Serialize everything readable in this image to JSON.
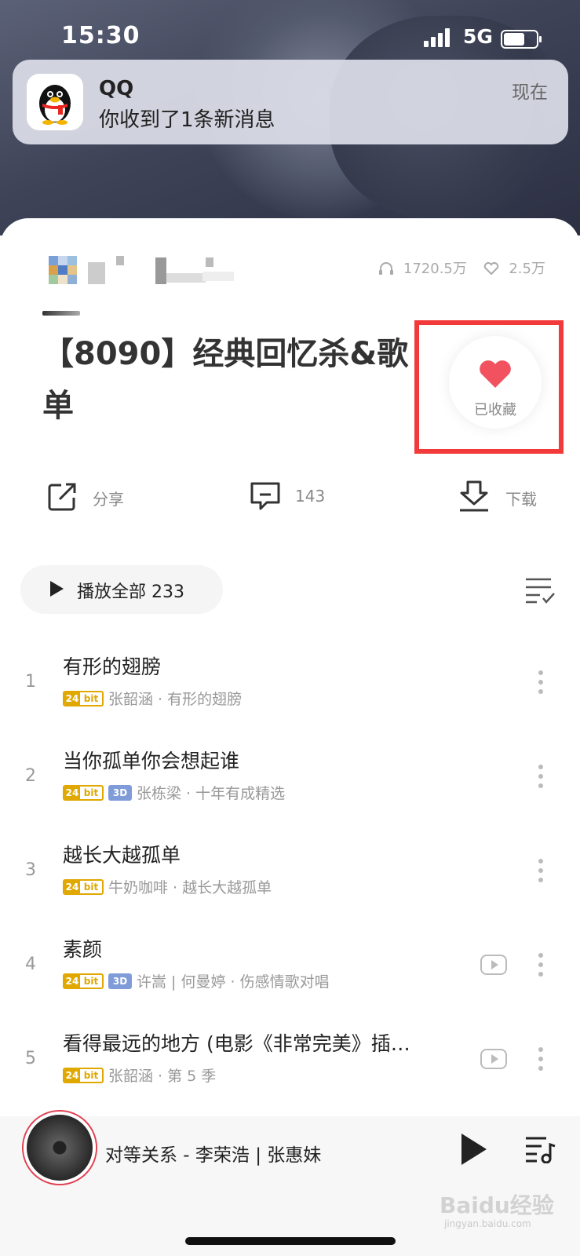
{
  "status_bar": {
    "time": "15:30",
    "network": "5G"
  },
  "notification": {
    "app": "QQ",
    "message": "你收到了1条新消息",
    "when": "现在"
  },
  "playlist": {
    "play_count": "1720.5万",
    "like_count": "2.5万",
    "title": "【8090】经典回忆杀&歌单",
    "favorite_label": "已收藏",
    "actions": {
      "share": "分享",
      "comments": "143",
      "download": "下载"
    },
    "play_all": "播放全部 233"
  },
  "badges": {
    "bit24_left": "24",
    "bit24_right": "bit",
    "three_d": "3D"
  },
  "songs": [
    {
      "num": "1",
      "title": "有形的翅膀",
      "meta": "张韶涵 · 有形的翅膀"
    },
    {
      "num": "2",
      "title": "当你孤单你会想起谁",
      "meta": "张栋梁 · 十年有成精选"
    },
    {
      "num": "3",
      "title": "越长大越孤单",
      "meta": "牛奶咖啡 · 越长大越孤单"
    },
    {
      "num": "4",
      "title": "素颜",
      "meta": "许嵩 | 何曼婷 · 伤感情歌对唱"
    },
    {
      "num": "5",
      "title": "看得最远的地方 (电影《非常完美》插…",
      "meta": "张韶涵 · 第 5 季"
    }
  ],
  "now_playing": {
    "track": "对等关系 - 李荣浩 | 张惠妹"
  },
  "watermark": {
    "brand": "Baidu经验",
    "url": "jingyan.baidu.com"
  },
  "colors": {
    "accent": "#f23a3a",
    "heart": "#f25260",
    "badge_gold": "#e0a800",
    "badge_3d": "#7f9bd8"
  }
}
